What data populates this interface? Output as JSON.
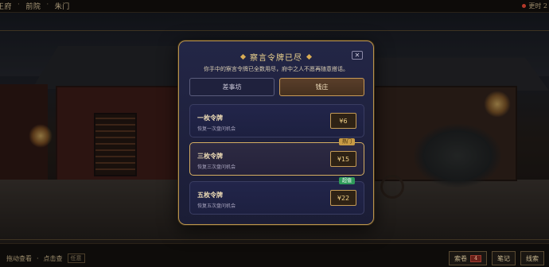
{
  "topbar": {
    "crumbs": [
      "王府",
      "前院",
      "朱门"
    ],
    "right_text": "更时 2"
  },
  "bottombar": {
    "left_text": "拖动查看",
    "left_text2": "点击查",
    "left_tag": "任意",
    "buttons": [
      {
        "label": "索卷",
        "badge": "4"
      },
      {
        "label": "笔记",
        "badge": ""
      },
      {
        "label": "线索",
        "badge": ""
      }
    ]
  },
  "modal": {
    "title": "察言令牌已尽",
    "close_label": "✕",
    "subtitle": "你手中的察言令牌已全数用尽，府中之人不愿再随意搭话。",
    "tabs": [
      {
        "label": "差事坊",
        "active": false
      },
      {
        "label": "钱庄",
        "active": true
      }
    ],
    "products": [
      {
        "name": "一枚令牌",
        "desc": "恢复一次盘问机会",
        "price": "¥6",
        "badge": ""
      },
      {
        "name": "三枚令牌",
        "desc": "恢复三次盘问机会",
        "price": "¥15",
        "badge": "热门"
      },
      {
        "name": "五枚令牌",
        "desc": "恢复五次盘问机会",
        "price": "¥22",
        "badge": "超值"
      }
    ]
  },
  "colors": {
    "accent_gold": "#d4ad62",
    "modal_bg": "#1f2140",
    "hot_badge": "#c79a45",
    "value_badge": "#2f9a5a"
  }
}
